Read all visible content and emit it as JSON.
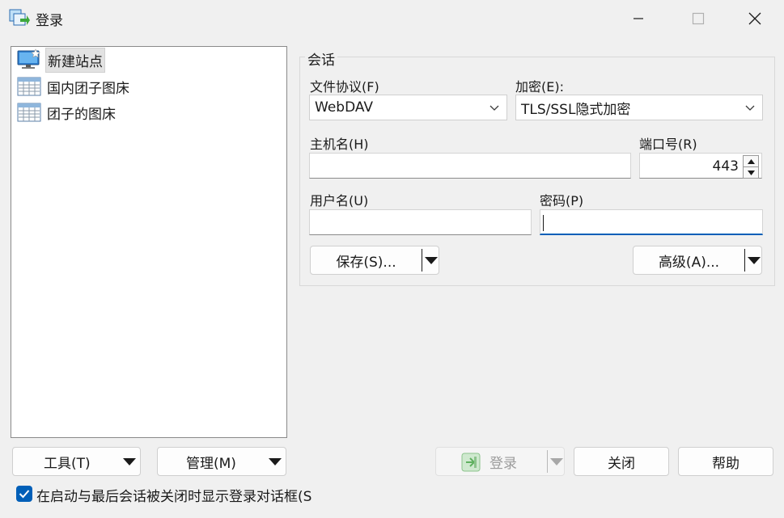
{
  "window": {
    "title": "登录",
    "icon": "winscp-login-icon",
    "controls": [
      "minimize-icon",
      "maximize-icon",
      "close-icon"
    ]
  },
  "sites": [
    {
      "label": "新建站点",
      "icon": "new-site-icon",
      "selected": true
    },
    {
      "label": "国内团子图床",
      "icon": "site-icon",
      "selected": false
    },
    {
      "label": "团子的图床",
      "icon": "site-icon",
      "selected": false
    }
  ],
  "session": {
    "group_label": "会话",
    "protocol_label": "文件协议(F)",
    "protocol_value": "WebDAV",
    "encryption_label": "加密(E):",
    "encryption_value": "TLS/SSL隐式加密",
    "host_label": "主机名(H)",
    "host_value": "",
    "port_label": "端口号(R)",
    "port_value": "443",
    "user_label": "用户名(U)",
    "user_value": "",
    "password_label": "密码(P)",
    "password_value": "",
    "save_label": "保存(S)...",
    "advanced_label": "高级(A)..."
  },
  "bottom": {
    "tools_label": "工具(T)",
    "manage_label": "管理(M)",
    "login_label": "登录",
    "close_label": "关闭",
    "help_label": "帮助",
    "show_dialog_label": "在启动与最后会话被关闭时显示登录对话框(S",
    "show_dialog_checked": true
  },
  "colors": {
    "accent": "#005fb8",
    "window_bg": "#f0f0f0",
    "disabled_text": "#9c9c9c"
  }
}
